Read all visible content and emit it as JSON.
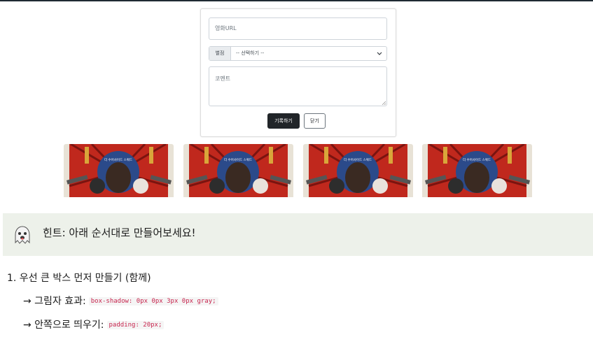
{
  "form": {
    "url_placeholder": "영화URL",
    "rating_label": "별점",
    "rating_selected": "-- 선택하기 --",
    "comment_placeholder": "코멘트",
    "save_button": "기록하기",
    "close_button": "닫기"
  },
  "posters": [
    {
      "title": "더 수어사이드 스쿼드"
    },
    {
      "title": "더 수어사이드 스쿼드"
    },
    {
      "title": "더 수어사이드 스쿼드"
    },
    {
      "title": "더 수어사이드 스쿼드"
    }
  ],
  "hint": {
    "icon": "ghost-icon",
    "text": "힌트: 아래 순서대로 만들어보세요!"
  },
  "steps": [
    {
      "label": "1.  우선 큰 박스 먼저 만들기 (함께)",
      "subs": [
        {
          "prefix": "→ 그림자 효과:",
          "code": "box-shadow: 0px 0px 3px 0px gray;"
        },
        {
          "prefix": "→ 안쪽으로 띄우기:",
          "code": "padding: 20px;"
        }
      ]
    }
  ],
  "colors": {
    "dark_button": "#212529",
    "hint_bg": "#edf1ea",
    "code_text": "#c7254e",
    "poster_red": "#c0281d"
  }
}
